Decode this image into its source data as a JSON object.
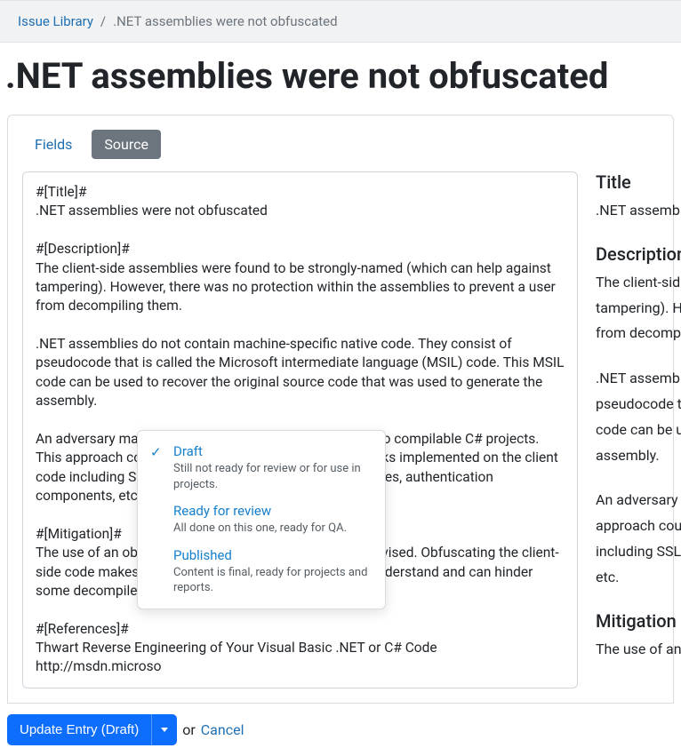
{
  "breadcrumb": {
    "root_label": "Issue Library",
    "current": ".NET assemblies were not obfuscated"
  },
  "page_title": ".NET assemblies were not obfuscated",
  "tabs": {
    "fields": "Fields",
    "source": "Source"
  },
  "source_text": "#[Title]#\n.NET assemblies were not obfuscated\n\n#[Description]#\nThe client-side assemblies were found to be strongly-named (which can help against tampering). However, there was no protection within the assemblies to prevent a user from decompiling them.\n\n.NET assemblies do not contain machine-specific native code. They consist of pseudocode that is called the Microsoft intermediate language (MSIL) code. This MSIL code can be used to recover the original source code that was used to generate the assembly.\n\nAn adversary may be able to reverse the binaries back into compilable C# projects.  This approach could be used to bypass the security checks implemented on the client code including SSL certificate checking, encryption routines, authentication components, etc.\n\n#[Mitigation]#\nThe use of an obfuscation tool such as Dotfuscator is advised. Obfuscating the client-side code makes the resulting reversed code harder to understand and can hinder some decompilers.\n\n#[References]#\nThwart Reverse Engineering of Your Visual Basic .NET or C# Code\nhttp://msdn.microso",
  "preview": {
    "title_heading": "Title",
    "title_value": ".NET assemb",
    "description_heading": "Description",
    "desc_p1_l1": "The client-sid",
    "desc_p1_l2": "tampering). H",
    "desc_p1_l3": "from decompi",
    "desc_p2_l1": ".NET assemb",
    "desc_p2_l2": "pseudocode t",
    "desc_p2_l3": "code can be u",
    "desc_p2_l4": "assembly.",
    "desc_p3_l1": "An adversary",
    "desc_p3_l2": "approach cou",
    "desc_p3_l3": "including SSL",
    "desc_p3_l4": "etc.",
    "mitigation_heading": "Mitigation",
    "mitigation_l1": "The use of an"
  },
  "status_menu": {
    "draft": {
      "label": "Draft",
      "desc": "Still not ready for review or for use in projects."
    },
    "ready": {
      "label": "Ready for review",
      "desc": "All done on this one, ready for QA."
    },
    "published": {
      "label": "Published",
      "desc": "Content is final, ready for projects and reports."
    }
  },
  "actions": {
    "update_label": "Update Entry (Draft)",
    "or_text": "or",
    "cancel_label": "Cancel"
  }
}
